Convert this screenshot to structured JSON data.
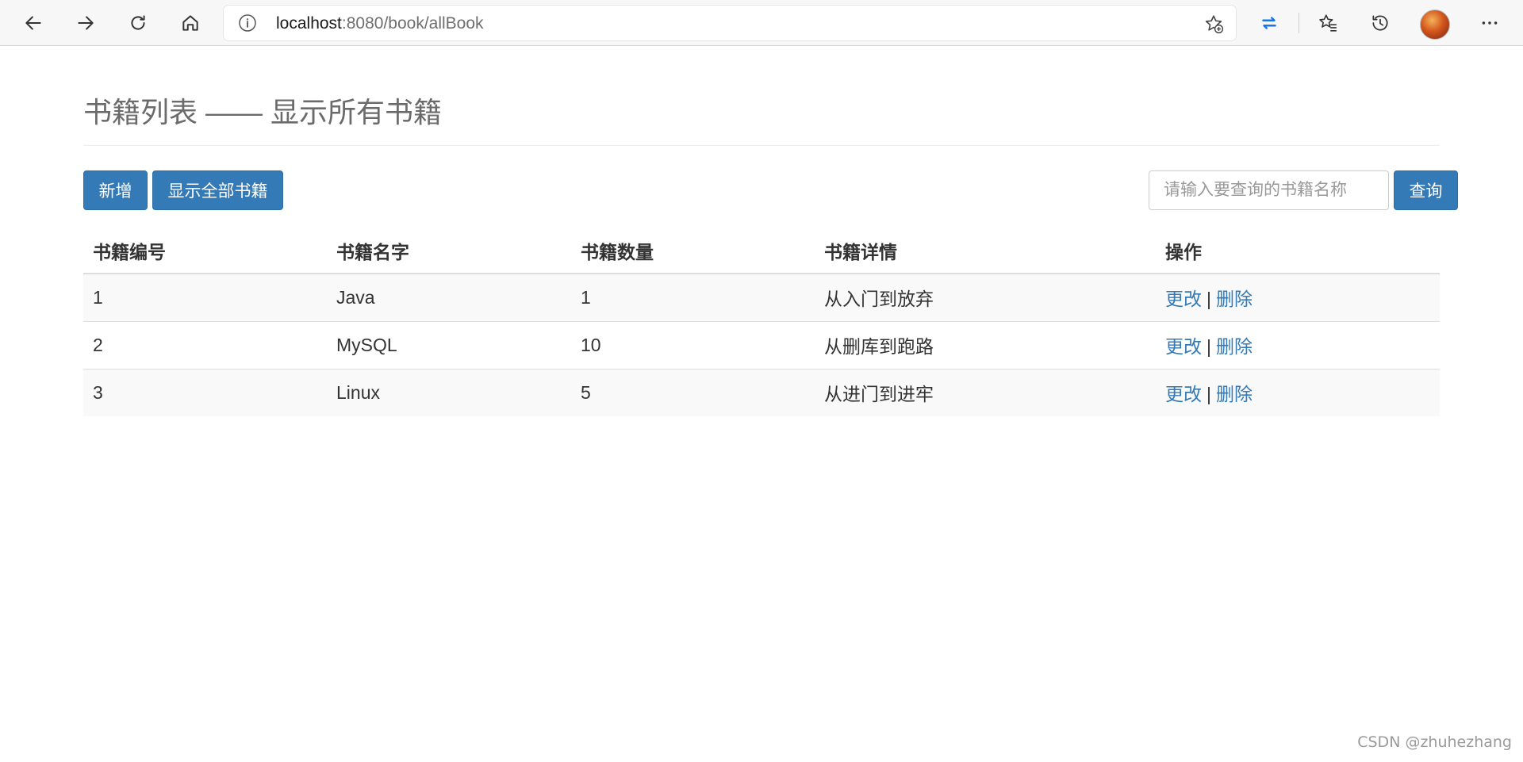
{
  "browser": {
    "url_host": "localhost",
    "url_rest": ":8080/book/allBook"
  },
  "page": {
    "title": "书籍列表 —— 显示所有书籍"
  },
  "actions": {
    "add_label": "新增",
    "show_all_label": "显示全部书籍",
    "search_placeholder": "请输入要查询的书籍名称",
    "query_label": "查询"
  },
  "table": {
    "headers": [
      "书籍编号",
      "书籍名字",
      "书籍数量",
      "书籍详情",
      "操作"
    ],
    "rows": [
      {
        "id": "1",
        "name": "Java",
        "count": "1",
        "detail": "从入门到放弃",
        "edit": "更改",
        "sep": "|",
        "delete": "删除"
      },
      {
        "id": "2",
        "name": "MySQL",
        "count": "10",
        "detail": "从删库到跑路",
        "edit": "更改",
        "sep": "|",
        "delete": "删除"
      },
      {
        "id": "3",
        "name": "Linux",
        "count": "5",
        "detail": "从进门到进牢",
        "edit": "更改",
        "sep": "|",
        "delete": "删除"
      }
    ]
  },
  "watermark": "CSDN @zhuhezhang"
}
